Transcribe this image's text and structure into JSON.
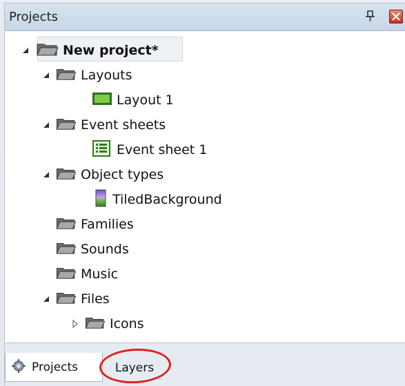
{
  "panel": {
    "title": "Projects"
  },
  "tree": {
    "root": "New project*",
    "layouts": "Layouts",
    "layout1": "Layout 1",
    "event_sheets": "Event sheets",
    "event_sheet1": "Event sheet 1",
    "object_types": "Object types",
    "tiled_background": "TiledBackground",
    "families": "Families",
    "sounds": "Sounds",
    "music": "Music",
    "files": "Files",
    "icons": "Icons"
  },
  "tabs": {
    "projects": "Projects",
    "layers": "Layers"
  },
  "icons": {
    "folder": "folder-icon",
    "layout": "layout-icon",
    "event_sheet": "event-sheet-icon",
    "sprite": "tiled-background-icon",
    "pin": "pin-icon",
    "close": "close-icon",
    "projects_tab": "gear-icon"
  },
  "colors": {
    "titlebar": "#c7d6e7",
    "close": "#c6321f",
    "annotation": "#e02020"
  }
}
